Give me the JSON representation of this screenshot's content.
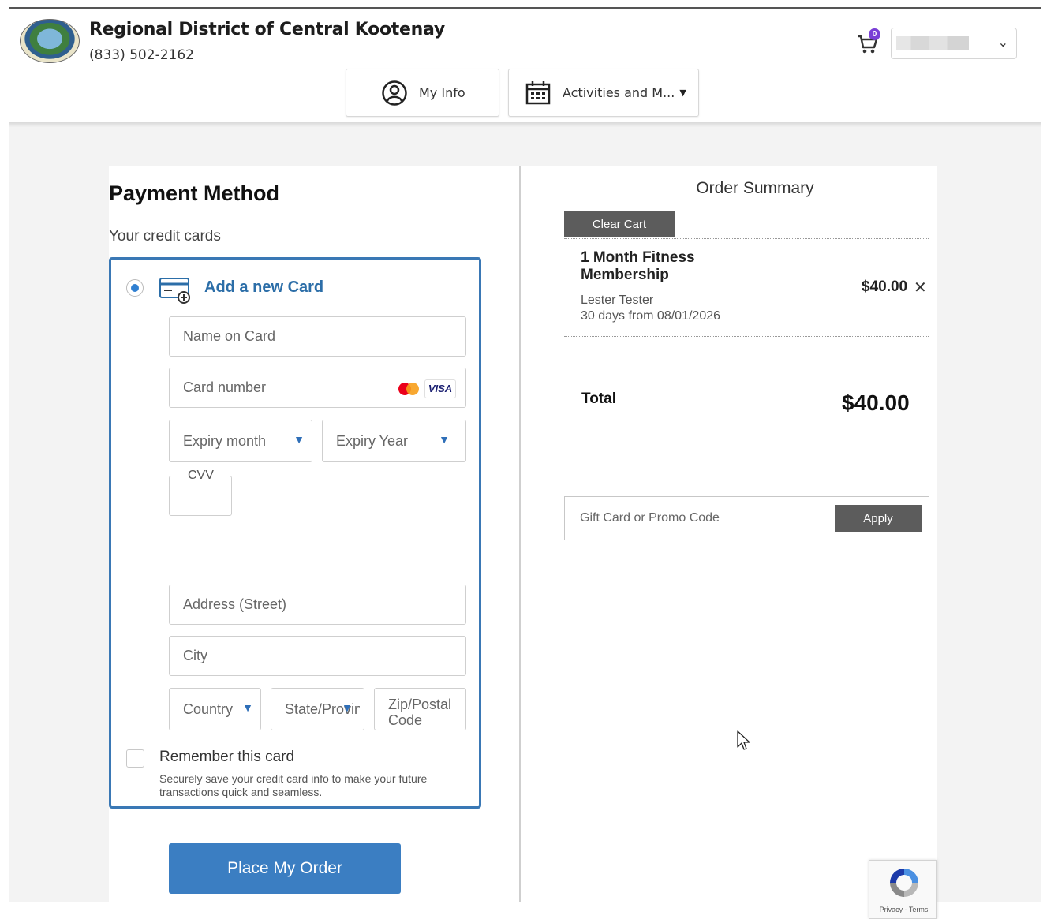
{
  "header": {
    "org_name": "Regional District of Central Kootenay",
    "phone": "(833) 502-2162",
    "cart_count": "0",
    "nav": {
      "my_info": "My Info",
      "activities": "Activities and M..."
    }
  },
  "payment": {
    "title": "Payment Method",
    "subtitle": "Your credit cards",
    "add_new_card": "Add a new Card",
    "name_on_card": "Name on Card",
    "card_number": "Card number",
    "card_brand_visa": "VISA",
    "expiry_month": "Expiry month",
    "expiry_year": "Expiry Year",
    "cvv": "CVV",
    "address": "Address (Street)",
    "city": "City",
    "country": "Country",
    "state": "State/Provinc",
    "zip_line1": "Zip/Postal",
    "zip_line2": "Code",
    "remember_label": "Remember this card",
    "remember_desc": "Securely save your credit card info to make your future transactions quick and seamless.",
    "place_order": "Place My Order"
  },
  "summary": {
    "title": "Order Summary",
    "clear_cart": "Clear Cart",
    "item": {
      "name": "1 Month Fitness Membership",
      "person": "Lester Tester",
      "dates": "30 days from 08/01/2026",
      "price": "$40.00",
      "remove": "✕"
    },
    "total_label": "Total",
    "total_value": "$40.00",
    "promo_placeholder": "Gift Card or Promo Code",
    "apply": "Apply"
  },
  "recaptcha": {
    "text": "Privacy - Terms"
  },
  "colors": {
    "accent": "#3a78b5",
    "button_primary": "#3b7ec2",
    "button_dark": "#5c5c5c",
    "badge": "#7a3fd6"
  }
}
